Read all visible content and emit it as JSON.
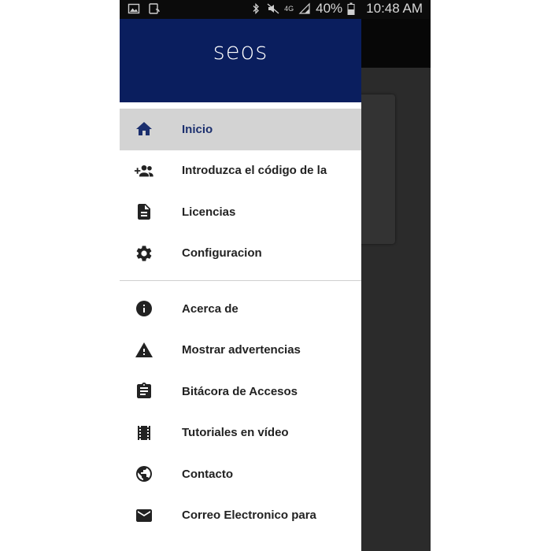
{
  "status_bar": {
    "battery": "40%",
    "time": "10:48 AM",
    "network": "4G",
    "icons": [
      "image-icon",
      "nfc-icon",
      "bluetooth-icon",
      "mute-icon",
      "signal-icon",
      "battery-icon"
    ]
  },
  "drawer": {
    "logo": "seos",
    "colors": {
      "header": "#0a1e5e",
      "active_bg": "#d3d3d3",
      "active_text": "#1b2f6e"
    },
    "items_top": [
      {
        "label": "Inicio",
        "icon": "home-icon",
        "active": true
      },
      {
        "label": "Introduzca el código de la",
        "icon": "add-group-icon",
        "active": false
      },
      {
        "label": "Licencias",
        "icon": "document-icon",
        "active": false
      },
      {
        "label": "Configuracion",
        "icon": "gear-icon",
        "active": false
      }
    ],
    "items_bottom": [
      {
        "label": "Acerca de",
        "icon": "info-icon"
      },
      {
        "label": "Mostrar advertencias",
        "icon": "warning-icon"
      },
      {
        "label": "Bitácora de Accesos",
        "icon": "clipboard-icon"
      },
      {
        "label": "Tutoriales en vídeo",
        "icon": "film-icon"
      },
      {
        "label": "Contacto",
        "icon": "globe-icon"
      },
      {
        "label": "Correo Electronico para",
        "icon": "mail-icon"
      }
    ]
  }
}
